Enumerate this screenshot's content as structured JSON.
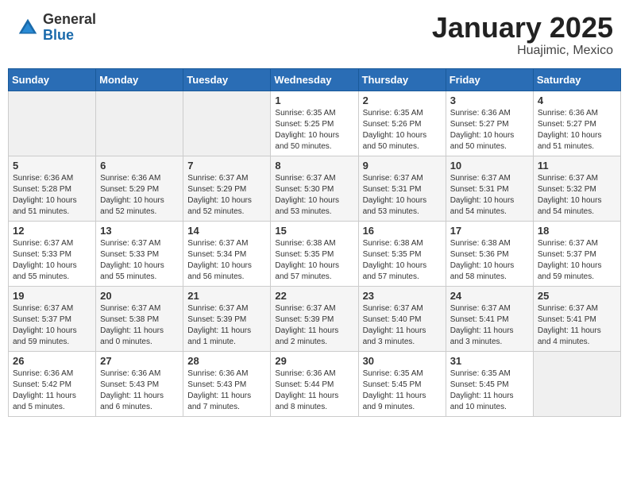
{
  "header": {
    "logo_general": "General",
    "logo_blue": "Blue",
    "title": "January 2025",
    "subtitle": "Huajimic, Mexico"
  },
  "days_of_week": [
    "Sunday",
    "Monday",
    "Tuesday",
    "Wednesday",
    "Thursday",
    "Friday",
    "Saturday"
  ],
  "weeks": [
    [
      {
        "day": "",
        "info": ""
      },
      {
        "day": "",
        "info": ""
      },
      {
        "day": "",
        "info": ""
      },
      {
        "day": "1",
        "info": "Sunrise: 6:35 AM\nSunset: 5:25 PM\nDaylight: 10 hours\nand 50 minutes."
      },
      {
        "day": "2",
        "info": "Sunrise: 6:35 AM\nSunset: 5:26 PM\nDaylight: 10 hours\nand 50 minutes."
      },
      {
        "day": "3",
        "info": "Sunrise: 6:36 AM\nSunset: 5:27 PM\nDaylight: 10 hours\nand 50 minutes."
      },
      {
        "day": "4",
        "info": "Sunrise: 6:36 AM\nSunset: 5:27 PM\nDaylight: 10 hours\nand 51 minutes."
      }
    ],
    [
      {
        "day": "5",
        "info": "Sunrise: 6:36 AM\nSunset: 5:28 PM\nDaylight: 10 hours\nand 51 minutes."
      },
      {
        "day": "6",
        "info": "Sunrise: 6:36 AM\nSunset: 5:29 PM\nDaylight: 10 hours\nand 52 minutes."
      },
      {
        "day": "7",
        "info": "Sunrise: 6:37 AM\nSunset: 5:29 PM\nDaylight: 10 hours\nand 52 minutes."
      },
      {
        "day": "8",
        "info": "Sunrise: 6:37 AM\nSunset: 5:30 PM\nDaylight: 10 hours\nand 53 minutes."
      },
      {
        "day": "9",
        "info": "Sunrise: 6:37 AM\nSunset: 5:31 PM\nDaylight: 10 hours\nand 53 minutes."
      },
      {
        "day": "10",
        "info": "Sunrise: 6:37 AM\nSunset: 5:31 PM\nDaylight: 10 hours\nand 54 minutes."
      },
      {
        "day": "11",
        "info": "Sunrise: 6:37 AM\nSunset: 5:32 PM\nDaylight: 10 hours\nand 54 minutes."
      }
    ],
    [
      {
        "day": "12",
        "info": "Sunrise: 6:37 AM\nSunset: 5:33 PM\nDaylight: 10 hours\nand 55 minutes."
      },
      {
        "day": "13",
        "info": "Sunrise: 6:37 AM\nSunset: 5:33 PM\nDaylight: 10 hours\nand 55 minutes."
      },
      {
        "day": "14",
        "info": "Sunrise: 6:37 AM\nSunset: 5:34 PM\nDaylight: 10 hours\nand 56 minutes."
      },
      {
        "day": "15",
        "info": "Sunrise: 6:38 AM\nSunset: 5:35 PM\nDaylight: 10 hours\nand 57 minutes."
      },
      {
        "day": "16",
        "info": "Sunrise: 6:38 AM\nSunset: 5:35 PM\nDaylight: 10 hours\nand 57 minutes."
      },
      {
        "day": "17",
        "info": "Sunrise: 6:38 AM\nSunset: 5:36 PM\nDaylight: 10 hours\nand 58 minutes."
      },
      {
        "day": "18",
        "info": "Sunrise: 6:37 AM\nSunset: 5:37 PM\nDaylight: 10 hours\nand 59 minutes."
      }
    ],
    [
      {
        "day": "19",
        "info": "Sunrise: 6:37 AM\nSunset: 5:37 PM\nDaylight: 10 hours\nand 59 minutes."
      },
      {
        "day": "20",
        "info": "Sunrise: 6:37 AM\nSunset: 5:38 PM\nDaylight: 11 hours\nand 0 minutes."
      },
      {
        "day": "21",
        "info": "Sunrise: 6:37 AM\nSunset: 5:39 PM\nDaylight: 11 hours\nand 1 minute."
      },
      {
        "day": "22",
        "info": "Sunrise: 6:37 AM\nSunset: 5:39 PM\nDaylight: 11 hours\nand 2 minutes."
      },
      {
        "day": "23",
        "info": "Sunrise: 6:37 AM\nSunset: 5:40 PM\nDaylight: 11 hours\nand 3 minutes."
      },
      {
        "day": "24",
        "info": "Sunrise: 6:37 AM\nSunset: 5:41 PM\nDaylight: 11 hours\nand 3 minutes."
      },
      {
        "day": "25",
        "info": "Sunrise: 6:37 AM\nSunset: 5:41 PM\nDaylight: 11 hours\nand 4 minutes."
      }
    ],
    [
      {
        "day": "26",
        "info": "Sunrise: 6:36 AM\nSunset: 5:42 PM\nDaylight: 11 hours\nand 5 minutes."
      },
      {
        "day": "27",
        "info": "Sunrise: 6:36 AM\nSunset: 5:43 PM\nDaylight: 11 hours\nand 6 minutes."
      },
      {
        "day": "28",
        "info": "Sunrise: 6:36 AM\nSunset: 5:43 PM\nDaylight: 11 hours\nand 7 minutes."
      },
      {
        "day": "29",
        "info": "Sunrise: 6:36 AM\nSunset: 5:44 PM\nDaylight: 11 hours\nand 8 minutes."
      },
      {
        "day": "30",
        "info": "Sunrise: 6:35 AM\nSunset: 5:45 PM\nDaylight: 11 hours\nand 9 minutes."
      },
      {
        "day": "31",
        "info": "Sunrise: 6:35 AM\nSunset: 5:45 PM\nDaylight: 11 hours\nand 10 minutes."
      },
      {
        "day": "",
        "info": ""
      }
    ]
  ]
}
